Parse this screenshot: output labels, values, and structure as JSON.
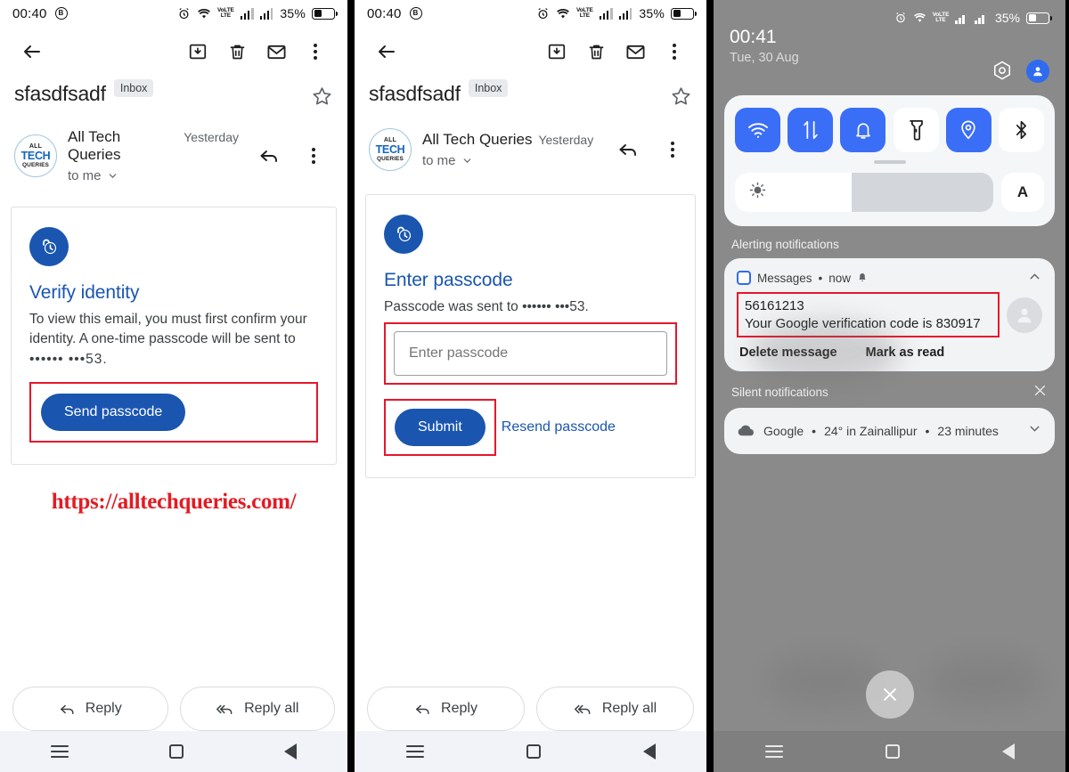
{
  "panels": {
    "gmail_verify": {
      "status_bar": {
        "time": "00:40",
        "battery_pct": "35%",
        "dnd_icon": "b-badge-icon"
      },
      "toolbar": {
        "back": "back-arrow",
        "archive": "archive-icon",
        "delete": "trash-icon",
        "mark_unread": "envelope-icon",
        "more": "kebab-menu"
      },
      "subject": "sfasdfsadf",
      "label_chip": "Inbox",
      "sender": {
        "name": "All Tech Queries",
        "time": "Yesterday",
        "recipient": "to me",
        "avatar_line1": "ALL",
        "avatar_line2": "TECH",
        "avatar_line3": "QUERIES"
      },
      "card": {
        "heading": "Verify identity",
        "body_part1": "To view this email, you must first confirm your identity. A one-time passcode will be sent to ",
        "masked_number": "•••••• •••53.",
        "button": "Send passcode"
      },
      "watermark": "https://alltechqueries.com/",
      "reply": "Reply",
      "reply_all": "Reply all"
    },
    "gmail_passcode": {
      "status_bar": {
        "time": "00:40",
        "battery_pct": "35%",
        "dnd_icon": "b-badge-icon"
      },
      "subject": "sfasdfsadf",
      "label_chip": "Inbox",
      "sender": {
        "name": "All Tech Queries",
        "time": "Yesterday",
        "recipient": "to me",
        "avatar_line1": "ALL",
        "avatar_line2": "TECH",
        "avatar_line3": "QUERIES"
      },
      "card": {
        "heading": "Enter passcode",
        "sent_text": "Passcode was sent to •••••• •••53.",
        "input_placeholder": "Enter passcode",
        "input_value": "",
        "submit": "Submit",
        "resend": "Resend passcode"
      },
      "reply": "Reply",
      "reply_all": "Reply all"
    },
    "notification_shade": {
      "status_bar": {
        "time": "00:41",
        "battery_pct": "35%",
        "alarm_icon": "alarm-icon"
      },
      "clock": "00:41",
      "date": "Tue, 30 Aug",
      "quick_settings": [
        {
          "name": "wifi-tile",
          "icon": "wifi-icon",
          "state": "on"
        },
        {
          "name": "mobile-data-tile",
          "icon": "data-transfer-icon",
          "state": "on"
        },
        {
          "name": "ring-mode-tile",
          "icon": "bell-icon",
          "state": "on"
        },
        {
          "name": "flashlight-tile",
          "icon": "flashlight-icon",
          "state": "off"
        },
        {
          "name": "location-tile",
          "icon": "location-pin-icon",
          "state": "on"
        },
        {
          "name": "bluetooth-tile",
          "icon": "bluetooth-icon",
          "state": "off"
        }
      ],
      "brightness": {
        "icon": "sun-icon",
        "level_pct": 45,
        "auto_label": "A"
      },
      "alerting_label": "Alerting notifications",
      "message_notification": {
        "app": "Messages",
        "time": "now",
        "separator": "•",
        "sender_number": "56161213",
        "body": "Your Google verification code is 830917",
        "action_delete": "Delete message",
        "action_mark_read": "Mark as read"
      },
      "silent_label": "Silent notifications",
      "weather_notification": {
        "app": "Google",
        "temp": "24° in Zainallipur",
        "age": "23 minutes"
      },
      "close_all": "close-all-button"
    }
  },
  "colors": {
    "gmail_blue": "#1a56b0",
    "highlight_red": "#e8152a",
    "watermark_red": "#e31b23",
    "tile_on_blue": "#3b6ef6",
    "shade_bg": "#8a8a8a"
  }
}
